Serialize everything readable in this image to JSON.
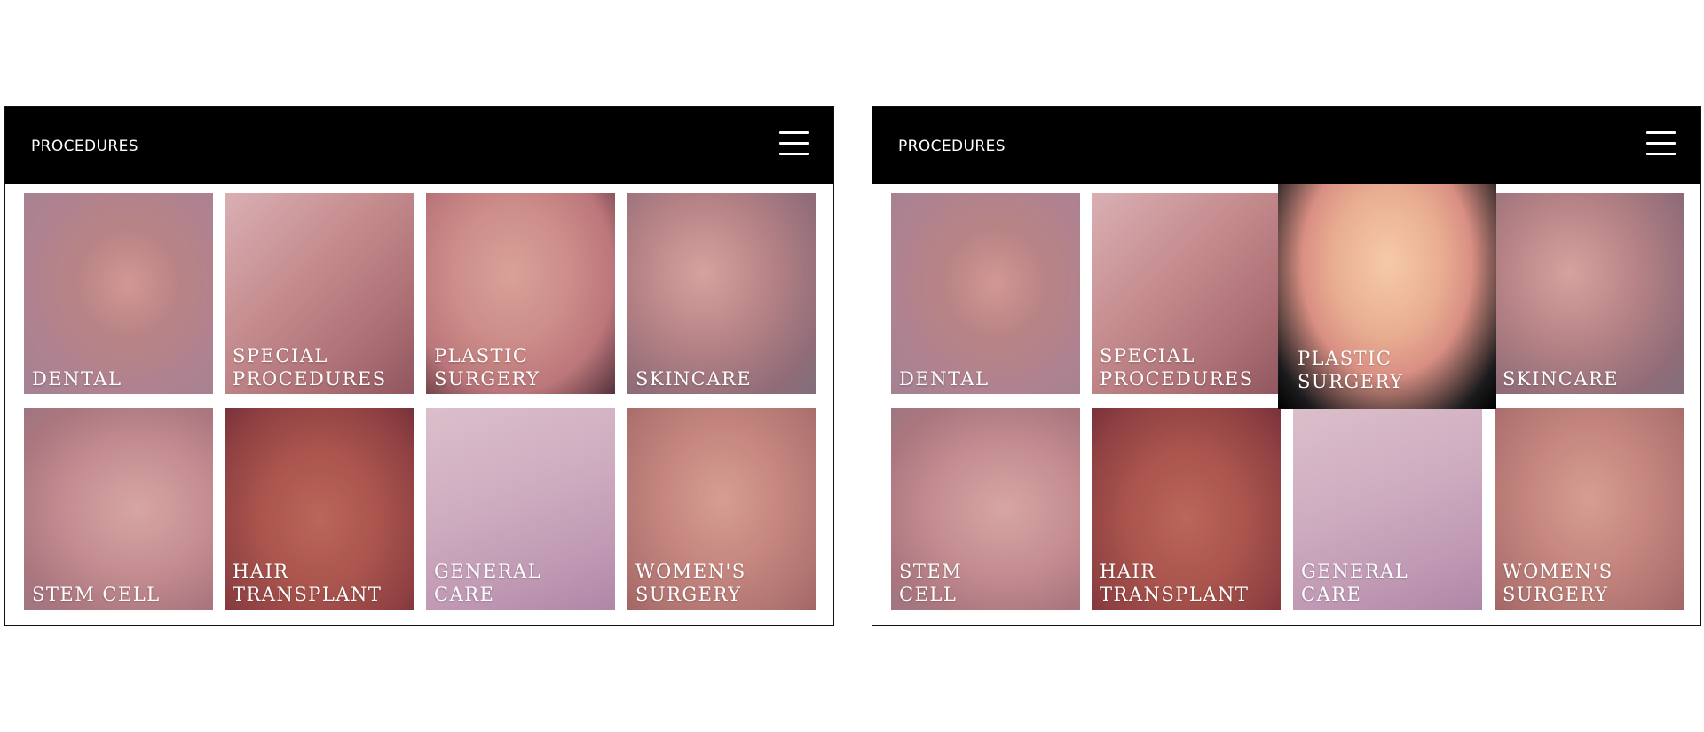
{
  "screens": [
    {
      "header": {
        "title": "PROCEDURES",
        "menu_icon": "hamburger-menu-icon"
      },
      "tiles": [
        {
          "label": "DENTAL"
        },
        {
          "label": "SPECIAL\nPROCEDURES"
        },
        {
          "label": "PLASTIC\nSURGERY"
        },
        {
          "label": "SKINCARE"
        },
        {
          "label": "STEM CELL"
        },
        {
          "label": "HAIR\nTRANSPLANT"
        },
        {
          "label": "GENERAL\nCARE"
        },
        {
          "label": "WOMEN'S\nSURGERY"
        }
      ]
    },
    {
      "header": {
        "title": "PROCEDURES",
        "menu_icon": "hamburger-menu-icon"
      },
      "highlighted_tile": "PLASTIC SURGERY",
      "tiles": [
        {
          "label": "DENTAL"
        },
        {
          "label": "SPECIAL\nPROCEDURES"
        },
        {
          "label": "PLASTIC\nSURGERY"
        },
        {
          "label": "SKINCARE"
        },
        {
          "label": "STEM\nCELL"
        },
        {
          "label": "HAIR\nTRANSPLANT"
        },
        {
          "label": "GENERAL\nCARE"
        },
        {
          "label": "WOMEN'S\nSURGERY"
        }
      ]
    }
  ],
  "colors": {
    "header_background": "#000000",
    "header_text": "#ffffff",
    "tile_tint": "#964660"
  }
}
